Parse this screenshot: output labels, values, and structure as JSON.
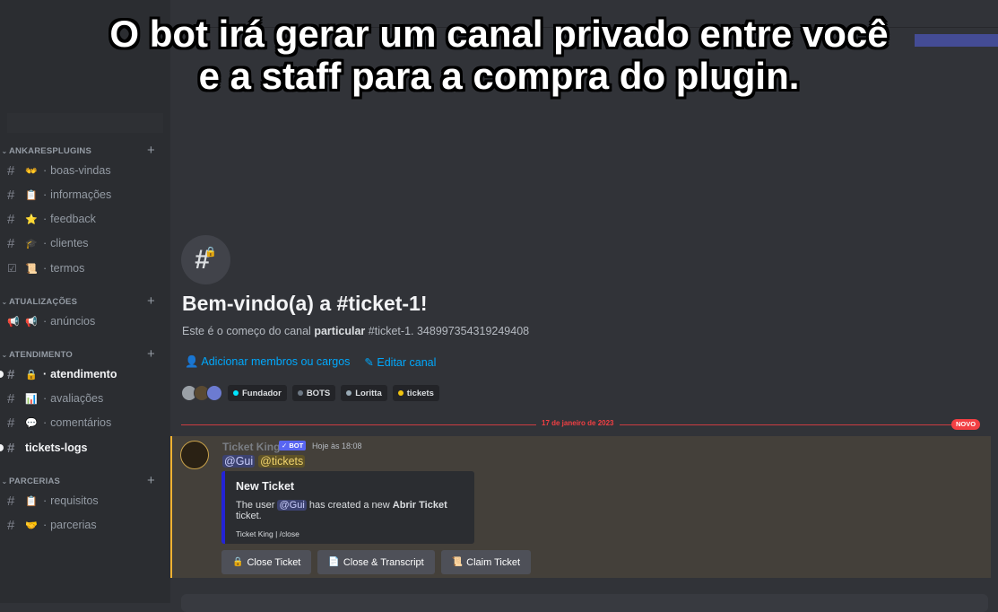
{
  "overlay": {
    "line1": "O bot irá gerar um canal privado entre você",
    "line2": "e a staff para a compra do plugin."
  },
  "sidebar": {
    "categories": [
      {
        "name": "ANKARESPLUGINS",
        "channels": [
          {
            "emoji": "👐",
            "label": "boas-vindas"
          },
          {
            "emoji": "📋",
            "label": "informações"
          },
          {
            "emoji": "⭐",
            "label": "feedback"
          },
          {
            "emoji": "🎓",
            "label": "clientes"
          },
          {
            "emoji": "📜",
            "label": "termos"
          }
        ]
      },
      {
        "name": "ATUALIZAÇÕES",
        "channels": [
          {
            "emoji": "📢",
            "label": "anúncios"
          }
        ]
      },
      {
        "name": "ATENDIMENTO",
        "channels": [
          {
            "emoji": "🔒",
            "label": "atendimento"
          },
          {
            "emoji": "📊",
            "label": "avaliações"
          },
          {
            "emoji": "💬",
            "label": "comentários"
          },
          {
            "emoji": "",
            "label": "tickets-logs"
          }
        ]
      },
      {
        "name": "PARCERIAS",
        "channels": [
          {
            "emoji": "📋",
            "label": "requisitos"
          },
          {
            "emoji": "🤝",
            "label": "parcerias"
          }
        ]
      }
    ]
  },
  "welcome": {
    "icon": "hash-lock-icon",
    "title": "Bem-vindo(a) a #ticket-1!",
    "desc_prefix": "Este é o começo do canal",
    "desc_bold": "particular",
    "desc_suffix": "#ticket-1. 348997354319249408",
    "add_members": "Adicionar membros ou cargos",
    "edit_channel": "Editar canal"
  },
  "roles": [
    {
      "name": "Fundador",
      "color": "#00e5ff"
    },
    {
      "name": "BOTS",
      "color": "#6d7884"
    },
    {
      "name": "Loritta",
      "color": "#99aab5"
    },
    {
      "name": "tickets",
      "color": "#f1c40f"
    }
  ],
  "divider": {
    "date": "17 de janeiro de 2023",
    "badge": "NOVO"
  },
  "message": {
    "author": "Ticket King",
    "bot_tag": "✓ BOT",
    "time": "Hoje às 18:08",
    "mention_user": "@Gui",
    "mention_role": "@tickets",
    "embed": {
      "title": "New Ticket",
      "body_prefix": "The user",
      "body_mention": "@Gui",
      "body_mid": "has created a new",
      "body_bold": "Abrir Ticket",
      "body_suffix": "ticket.",
      "footer": "Ticket King | /close"
    },
    "buttons": [
      {
        "emoji": "🔒",
        "label": "Close Ticket"
      },
      {
        "emoji": "📄",
        "label": "Close & Transcript"
      },
      {
        "emoji": "📜",
        "label": "Claim Ticket"
      }
    ]
  },
  "colors": {
    "accent": "#5865f2",
    "link": "#00a8fc",
    "new": "#f23f43",
    "highlight": "#f0b232"
  }
}
